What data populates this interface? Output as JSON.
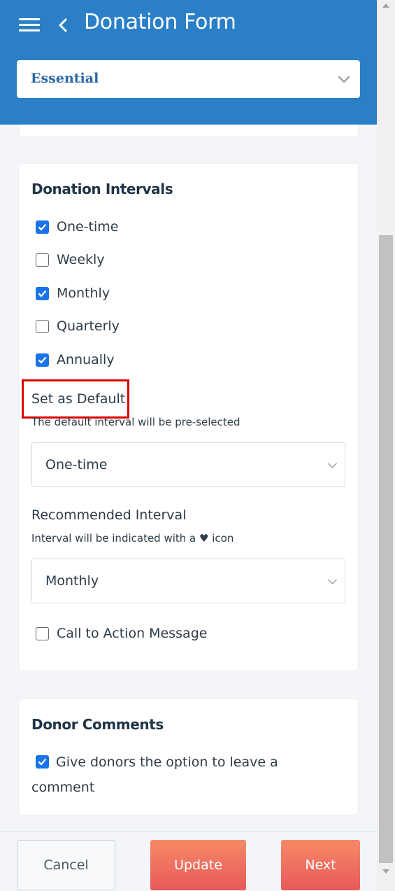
{
  "header": {
    "title": "Donation Form",
    "plan_select_value": "Essential",
    "color": "#2a7fc7"
  },
  "intervals_card": {
    "heading": "Donation Intervals",
    "options": [
      {
        "label": "One-time",
        "checked": true
      },
      {
        "label": "Weekly",
        "checked": false
      },
      {
        "label": "Monthly",
        "checked": true
      },
      {
        "label": "Quarterly",
        "checked": false
      },
      {
        "label": "Annually",
        "checked": true
      }
    ],
    "default_label": "Set as Default",
    "default_help": "The default interval will be pre-selected",
    "default_value": "One-time",
    "recommended_label": "Recommended Interval",
    "recommended_help": "Interval will be indicated with a ♥ icon",
    "recommended_value": "Monthly",
    "cta_label": "Call to Action Message",
    "cta_checked": false
  },
  "comments_card": {
    "heading": "Donor Comments",
    "option_label": "Give donors the option to leave a comment",
    "option_checked": true
  },
  "footer": {
    "cancel_label": "Cancel",
    "update_label": "Update",
    "next_label": "Next"
  },
  "icons": {
    "menu": "hamburger-menu-icon",
    "back": "chevron-left-icon",
    "dropdown": "chevron-down-icon",
    "checkbox": "checkmark-icon"
  },
  "colors": {
    "accent": "#2a7fc7",
    "checkbox": "#1a73e8",
    "primary_button": "#ee7160",
    "highlight": "#e00000"
  }
}
